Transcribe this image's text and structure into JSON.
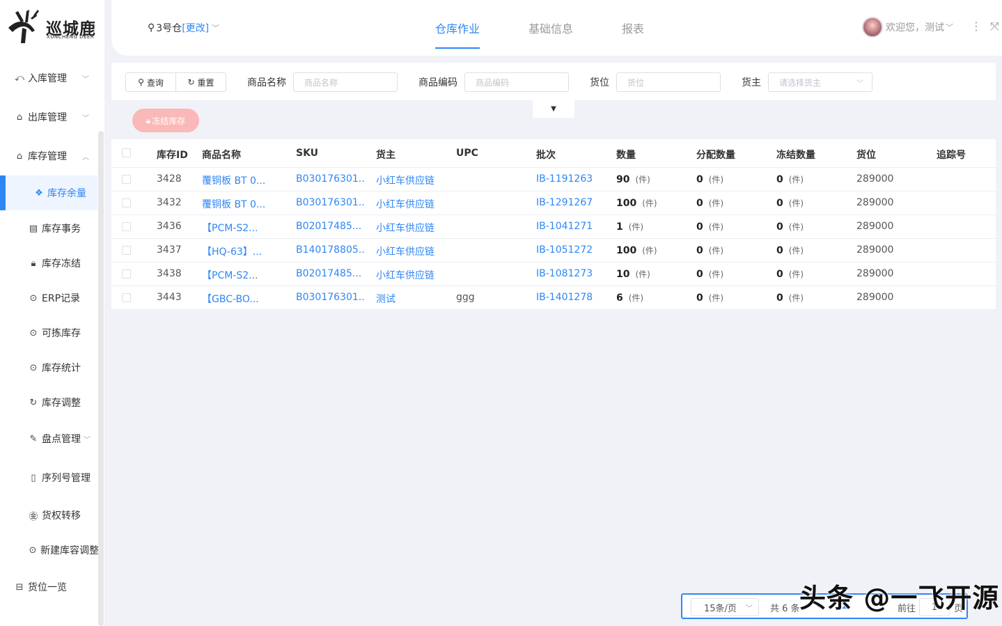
{
  "brand": {
    "name_cn": "巡城鹿",
    "name_en": "XUNCHENG DEER"
  },
  "header": {
    "warehouse": "3号仓",
    "change_link": "[更改]",
    "tabs": [
      {
        "label": "仓库作业",
        "active": true
      },
      {
        "label": "基础信息",
        "active": false
      },
      {
        "label": "报表",
        "active": false
      }
    ],
    "user_greeting": "欢迎您，测试"
  },
  "sidebar": {
    "items": [
      {
        "label": "入库管理",
        "icon": "inbound-icon"
      },
      {
        "label": "出库管理",
        "icon": "outbound-icon"
      },
      {
        "label": "库存管理",
        "icon": "warehouse-icon"
      },
      {
        "label": "库存余量",
        "icon": "boxes-icon",
        "active": true
      },
      {
        "label": "库存事务",
        "icon": "ledger-icon"
      },
      {
        "label": "库存冻结",
        "icon": "lock-icon"
      },
      {
        "label": "ERP记录",
        "icon": "dots-circle-icon"
      },
      {
        "label": "可拣库存",
        "icon": "dots-circle-icon"
      },
      {
        "label": "库存统计",
        "icon": "dots-circle-icon"
      },
      {
        "label": "库存调整",
        "icon": "refresh-icon"
      },
      {
        "label": "盘点管理",
        "icon": "edit-icon"
      },
      {
        "label": "序列号管理",
        "icon": "document-icon"
      },
      {
        "label": "货权转移",
        "icon": "transfer-icon"
      },
      {
        "label": "新建库容调整",
        "icon": "dots-circle-icon"
      },
      {
        "label": "货位一览",
        "icon": "shelf-icon"
      }
    ]
  },
  "filter": {
    "query_label": "查询",
    "reset_label": "重置",
    "product_name_label": "商品名称",
    "product_name_placeholder": "商品名称",
    "product_code_label": "商品编码",
    "product_code_placeholder": "商品编码",
    "location_label": "货位",
    "location_placeholder": "货位",
    "owner_label": "货主",
    "owner_placeholder": "请选择货主"
  },
  "actions": {
    "freeze_label": "冻结库存"
  },
  "table": {
    "columns": [
      "库存ID",
      "商品名称",
      "SKU",
      "货主",
      "UPC",
      "批次",
      "数量",
      "分配数量",
      "冻结数量",
      "货位",
      "追踪号"
    ],
    "unit": "(件)",
    "rows": [
      {
        "id": "3428",
        "name": "覆铜板 BT 0...",
        "sku": "B030176301...",
        "owner": "小红车供应链",
        "upc": "",
        "batch": "IB-1191263",
        "qty": "90",
        "alloc": "0",
        "frozen": "0",
        "location": "289000",
        "track": ""
      },
      {
        "id": "3432",
        "name": "覆铜板 BT 0...",
        "sku": "B030176301...",
        "owner": "小红车供应链",
        "upc": "",
        "batch": "IB-1291267",
        "qty": "100",
        "alloc": "0",
        "frozen": "0",
        "location": "289000",
        "track": ""
      },
      {
        "id": "3436",
        "name": "【PCM-S2...",
        "sku": "B02017485...",
        "owner": "小红车供应链",
        "upc": "",
        "batch": "IB-1041271",
        "qty": "1",
        "alloc": "0",
        "frozen": "0",
        "location": "289000",
        "track": ""
      },
      {
        "id": "3437",
        "name": "【HQ-63】...",
        "sku": "B140178805...",
        "owner": "小红车供应链",
        "upc": "",
        "batch": "IB-1051272",
        "qty": "100",
        "alloc": "0",
        "frozen": "0",
        "location": "289000",
        "track": ""
      },
      {
        "id": "3438",
        "name": "【PCM-S2...",
        "sku": "B02017485...",
        "owner": "小红车供应链",
        "upc": "",
        "batch": "IB-1081273",
        "qty": "10",
        "alloc": "0",
        "frozen": "0",
        "location": "289000",
        "track": ""
      },
      {
        "id": "3443",
        "name": "【GBC-BO...",
        "sku": "B030176301...",
        "owner": "测试",
        "upc": "ggg",
        "batch": "IB-1401278",
        "qty": "6",
        "alloc": "0",
        "frozen": "0",
        "location": "289000",
        "track": ""
      }
    ]
  },
  "pagination": {
    "page_size": "15条/页",
    "total": "共 6 条",
    "current_page": "1",
    "goto_label": "前往",
    "goto_value": "1",
    "page_suffix": "页"
  },
  "watermark": "头条 @一飞开源",
  "colors": {
    "accent": "#2e86f5",
    "freeze_button": "#fbb8b8",
    "background": "#f0f2f7"
  }
}
